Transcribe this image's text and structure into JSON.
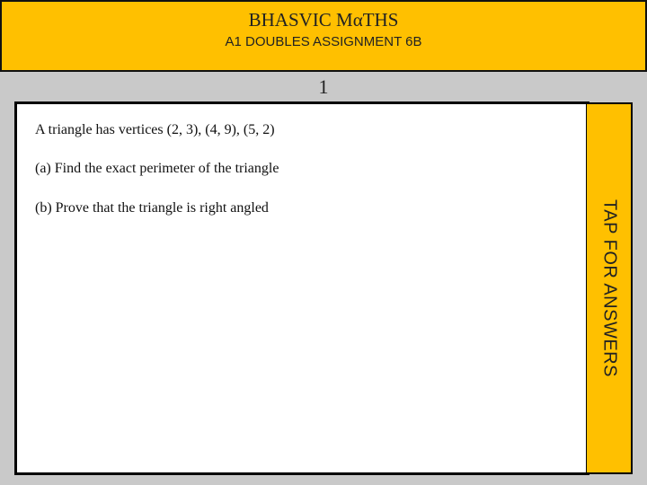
{
  "header": {
    "title": "BHASVIC MαTHS",
    "subtitle": "A1 DOUBLES ASSIGNMENT 6B"
  },
  "slide_number": "1",
  "question": {
    "intro": "A triangle has vertices  (2, 3), (4, 9), (5, 2)",
    "part_a": "(a) Find the exact perimeter of the triangle",
    "part_b": "(b) Prove that the triangle is right angled"
  },
  "answers_tab": {
    "label": "TAP FOR ANSWERS"
  },
  "colors": {
    "accent": "#ffc000",
    "background": "#c9c9c9"
  }
}
